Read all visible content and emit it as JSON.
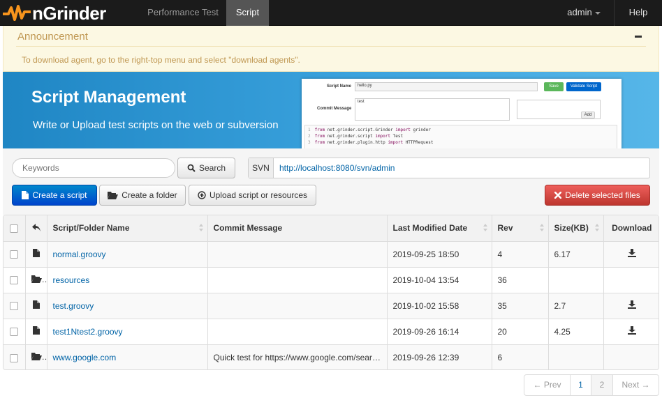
{
  "navbar": {
    "brand": "nGrinder",
    "items": [
      {
        "label": "Performance Test"
      },
      {
        "label": "Script"
      }
    ],
    "user": "admin",
    "help": "Help"
  },
  "announcement": {
    "title": "Announcement",
    "body": "To download agent, go to the right-top menu and select \"download agents\"."
  },
  "banner": {
    "title": "Script Management",
    "subtitle": "Write or Upload test scripts on the web or subversion",
    "mock": {
      "script_name_label": "Script Name",
      "script_name_value": "hello.py",
      "save": "Save",
      "validate": "Validate Script",
      "commit_label": "Commit Message",
      "commit_value": "test",
      "add": "Add",
      "code_lines": [
        {
          "n": "1",
          "kw": "from",
          "a": " net.grinder.script.Grinder ",
          "kw2": "import",
          "b": " grinder"
        },
        {
          "n": "2",
          "kw": "from",
          "a": " net.grinder.script ",
          "kw2": "import",
          "b": " Test"
        },
        {
          "n": "3",
          "kw": "from",
          "a": " net.grinder.plugin.http ",
          "kw2": "import",
          "b": " HTTPRequest"
        }
      ]
    }
  },
  "toolbar": {
    "search_placeholder": "Keywords",
    "search_button": "Search",
    "svn_label": "SVN",
    "svn_url": "http://localhost:8080/svn/admin",
    "create_script": "Create a script",
    "create_folder": "Create a folder",
    "upload": "Upload script or resources",
    "delete": "Delete selected files"
  },
  "table": {
    "headers": {
      "name": "Script/Folder Name",
      "commit": "Commit Message",
      "modified": "Last Modified Date",
      "rev": "Rev",
      "size": "Size(KB)",
      "download": "Download"
    },
    "rows": [
      {
        "type": "file",
        "name": "normal.groovy",
        "commit": "",
        "modified": "2019-09-25 18:50",
        "rev": "4",
        "size": "6.17",
        "download": true
      },
      {
        "type": "folder",
        "name": "resources",
        "commit": "",
        "modified": "2019-10-04 13:54",
        "rev": "36",
        "size": "",
        "download": false
      },
      {
        "type": "file",
        "name": "test.groovy",
        "commit": "",
        "modified": "2019-10-02 15:58",
        "rev": "35",
        "size": "2.7",
        "download": true
      },
      {
        "type": "file",
        "name": "test1Ntest2.groovy",
        "commit": "",
        "modified": "2019-09-26 16:14",
        "rev": "20",
        "size": "4.25",
        "download": true
      },
      {
        "type": "folder",
        "name": "www.google.com",
        "commit": "Quick test for https://www.google.com/search",
        "modified": "2019-09-26 12:39",
        "rev": "6",
        "size": "",
        "download": false
      }
    ]
  },
  "pagination": {
    "prev": "← Prev",
    "pages": [
      "1",
      "2"
    ],
    "next": "Next →"
  },
  "colors": {
    "navbar": "#1b1b1b",
    "brand_logo": "#f7941d",
    "link": "#0063a6",
    "primary": "#0066cc",
    "danger": "#d9534f",
    "announcement_bg": "#fcf8e3",
    "banner": "#2a93d2"
  }
}
